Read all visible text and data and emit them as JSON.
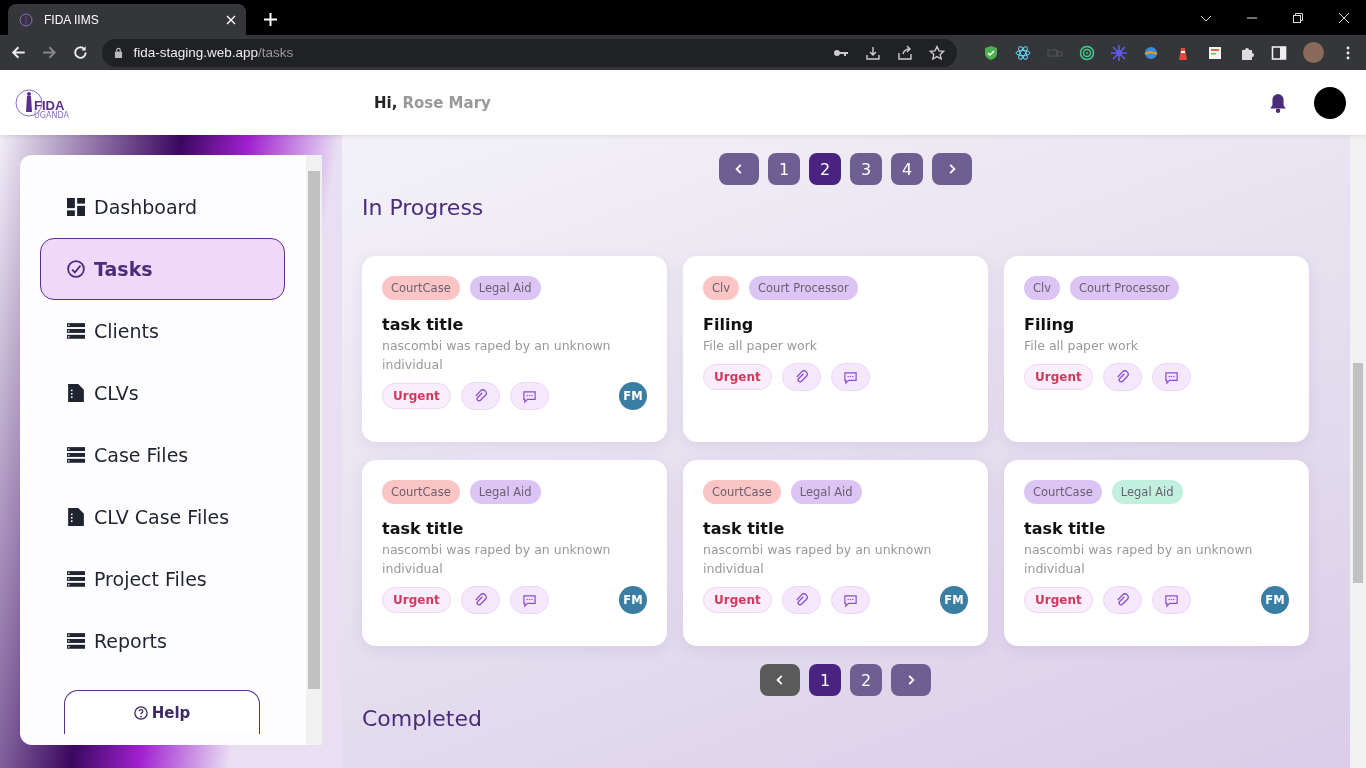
{
  "browser": {
    "tab_title": "FIDA IIMS",
    "url_host": "fida-staging.web.app",
    "url_path": "/tasks"
  },
  "header": {
    "logo_text": "FIDA",
    "logo_subtext": "UGANDA",
    "greeting": "Hi,",
    "user_name": "Rose Mary"
  },
  "sidebar": {
    "items": [
      {
        "label": "Dashboard",
        "kind": "dashboard",
        "selected": false
      },
      {
        "label": "Tasks",
        "kind": "tasks",
        "selected": true
      },
      {
        "label": "Clients",
        "kind": "list",
        "selected": false
      },
      {
        "label": "CLVs",
        "kind": "document",
        "selected": false
      },
      {
        "label": "Case Files",
        "kind": "list",
        "selected": false
      },
      {
        "label": "CLV Case Files",
        "kind": "document",
        "selected": false
      },
      {
        "label": "Project Files",
        "kind": "list",
        "selected": false
      },
      {
        "label": "Reports",
        "kind": "list",
        "selected": false
      }
    ],
    "help": "Help"
  },
  "top_pagination": {
    "prev_disabled": false,
    "pages": [
      {
        "label": "1",
        "selected": false
      },
      {
        "label": "2",
        "selected": true
      },
      {
        "label": "3",
        "selected": false
      },
      {
        "label": "4",
        "selected": false
      }
    ]
  },
  "section_title": "In Progress",
  "cards": [
    {
      "tags": [
        {
          "label": "CourtCase",
          "color": "#fcc5c5"
        },
        {
          "label": "Legal Aid",
          "color": "#dcc5f5"
        }
      ],
      "title": "task title",
      "description": "nascombi was raped by an unknown individual",
      "priority": "Urgent",
      "assignee": "FM"
    },
    {
      "tags": [
        {
          "label": "Clv",
          "color": "#fcc5c5"
        },
        {
          "label": "Court Processor",
          "color": "#dcc5f5"
        }
      ],
      "title": "Filing",
      "description": "File all paper work",
      "priority": "Urgent"
    },
    {
      "tags": [
        {
          "label": "Clv",
          "color": "#dcc5f5"
        },
        {
          "label": "Court Processor",
          "color": "#dcc5f5"
        }
      ],
      "title": "Filing",
      "description": "File all paper work",
      "priority": "Urgent"
    },
    {
      "tags": [
        {
          "label": "CourtCase",
          "color": "#fcc5c5"
        },
        {
          "label": "Legal Aid",
          "color": "#dcc5f5"
        }
      ],
      "title": "task title",
      "description": "nascombi was raped by an unknown individual",
      "priority": "Urgent",
      "assignee": "FM"
    },
    {
      "tags": [
        {
          "label": "CourtCase",
          "color": "#fcc5c5"
        },
        {
          "label": "Legal Aid",
          "color": "#dcc5f5"
        }
      ],
      "title": "task title",
      "description": "nascombi was raped by an unknown individual",
      "priority": "Urgent",
      "assignee": "FM"
    },
    {
      "tags": [
        {
          "label": "CourtCase",
          "color": "#dcc5f5"
        },
        {
          "label": "Legal Aid",
          "color": "#c2f0df"
        }
      ],
      "title": "task title",
      "description": "nascombi was raped by an unknown individual",
      "priority": "Urgent",
      "assignee": "FM"
    }
  ],
  "bottom_pagination": {
    "prev_disabled": true,
    "pages": [
      {
        "label": "1",
        "selected": true
      },
      {
        "label": "2",
        "selected": false
      }
    ]
  },
  "next_section_title": "Completed"
}
